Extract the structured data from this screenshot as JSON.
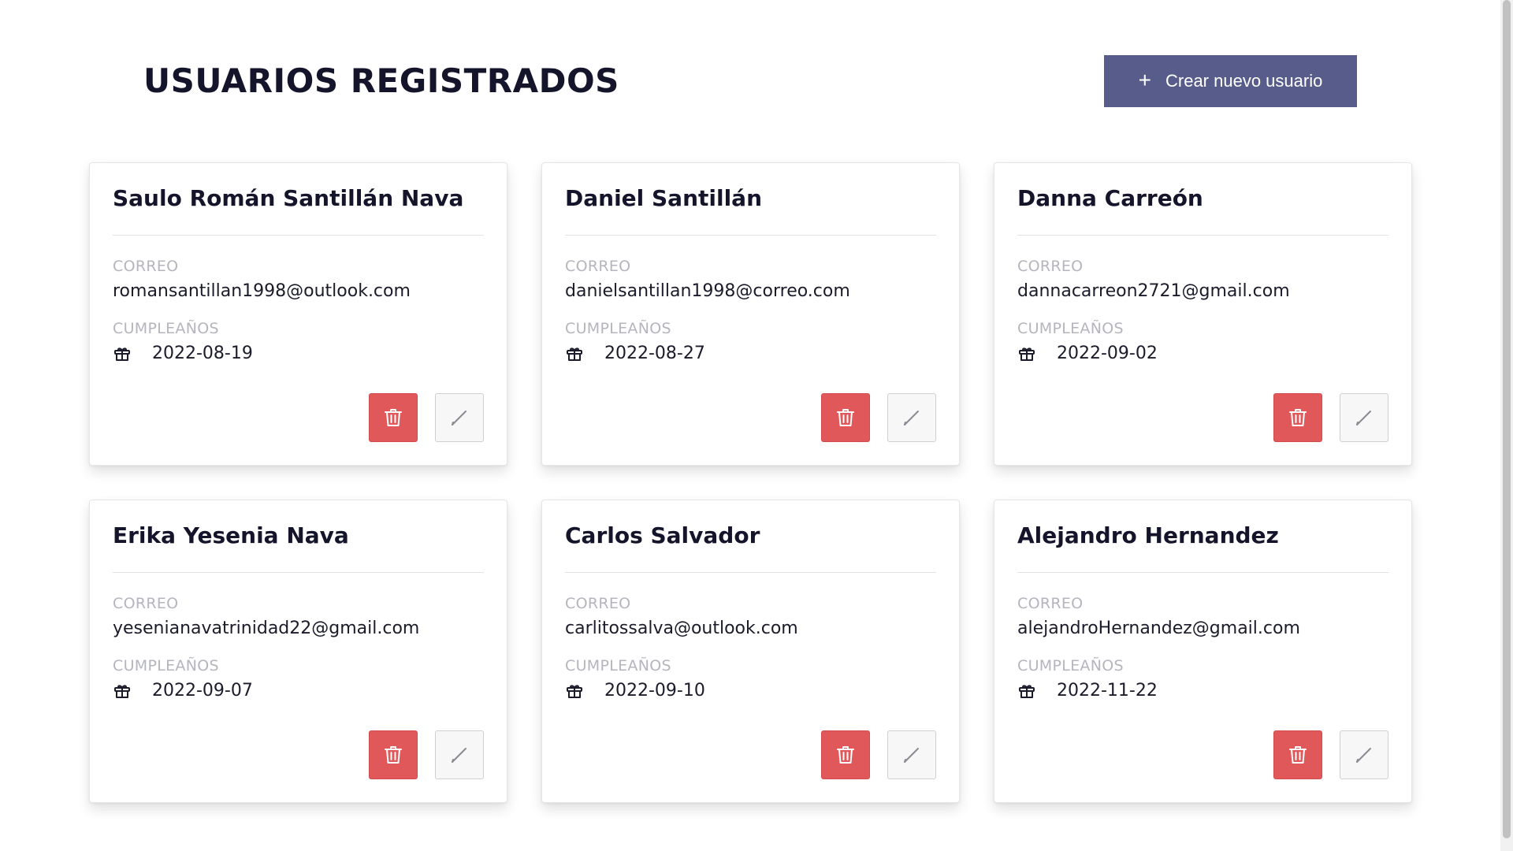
{
  "header": {
    "title": "USUARIOS REGISTRADOS",
    "create_button_label": "Crear nuevo usuario",
    "create_button_icon": "plus-icon"
  },
  "labels": {
    "email": "CORREO",
    "birthday": "CUMPLEAÑOS"
  },
  "colors": {
    "primary": "#585c8b",
    "danger": "#e0585a",
    "label": "#b5b5bd"
  },
  "users": [
    {
      "name": "Saulo Román Santillán Nava",
      "email": "romansantillan1998@outlook.com",
      "birthday": "2022-08-19"
    },
    {
      "name": "Daniel Santillán",
      "email": "danielsantillan1998@correo.com",
      "birthday": "2022-08-27"
    },
    {
      "name": "Danna Carreón",
      "email": "dannacarreon2721@gmail.com",
      "birthday": "2022-09-02"
    },
    {
      "name": "Erika Yesenia Nava",
      "email": "yesenianavatrinidad22@gmail.com",
      "birthday": "2022-09-07"
    },
    {
      "name": "Carlos Salvador",
      "email": "carlitossalva@outlook.com",
      "birthday": "2022-09-10"
    },
    {
      "name": "Alejandro Hernandez",
      "email": "alejandroHernandez@gmail.com",
      "birthday": "2022-11-22"
    }
  ]
}
